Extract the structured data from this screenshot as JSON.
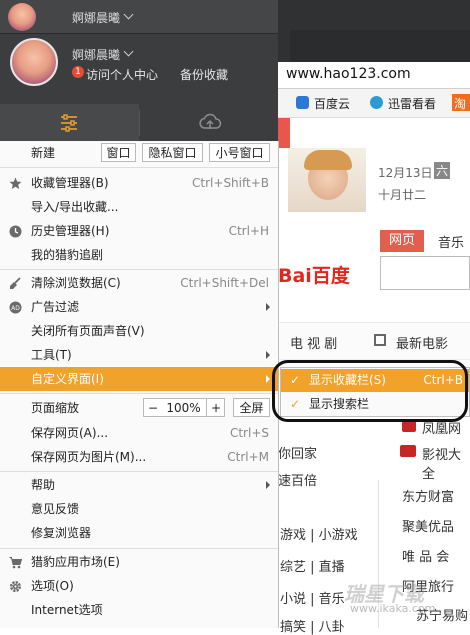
{
  "profile": {
    "username": "婀娜晨曦",
    "badge_count": "1",
    "personal_center": "访问个人中心",
    "backup": "备份收藏"
  },
  "browser": {
    "url": "www.hao123.com",
    "favorites": [
      {
        "label": "百度云",
        "icon": "cloud-icon"
      },
      {
        "label": "迅雷看看",
        "icon": "play-icon"
      },
      {
        "label": "淘",
        "icon": "taobao-icon"
      }
    ]
  },
  "page": {
    "date": "12月13日",
    "weekday": "六",
    "lunar": "十月廿二",
    "baidu_logo": "Bai百度",
    "search_tabs": [
      "网页",
      "音乐"
    ],
    "nav": [
      "电 视 剧",
      "最新电影"
    ],
    "side_links": [
      "凤凰网",
      "影视大全"
    ],
    "left_links": [
      "你回家",
      "速百倍"
    ],
    "grid_links": [
      "游戏 | 小游戏",
      "综艺 | 直播",
      "小说 | 音乐",
      "搞笑 | 八卦"
    ],
    "right_links": [
      "东方财富",
      "聚美优品",
      "唯 品 会",
      "阿里旅行",
      "苏宁易购"
    ],
    "watermark": "瑞星下载",
    "watermark_url": "www.ikaka.com"
  },
  "menu": {
    "new_label": "新建",
    "new_buttons": [
      "窗口",
      "隐私窗口",
      "小号窗口"
    ],
    "items": [
      {
        "label": "收藏管理器(B)",
        "shortcut": "Ctrl+Shift+B",
        "icon": "star-icon"
      },
      {
        "label": "导入/导出收藏...",
        "shortcut": ""
      },
      {
        "label": "历史管理器(H)",
        "shortcut": "Ctrl+H",
        "icon": "history-icon"
      },
      {
        "label": "我的猎豹追剧",
        "shortcut": ""
      },
      {
        "label": "清除浏览数据(C)",
        "shortcut": "Ctrl+Shift+Del",
        "icon": "broom-icon"
      },
      {
        "label": "广告过滤",
        "shortcut": "",
        "icon": "adblock-icon"
      },
      {
        "label": "关闭所有页面声音(V)",
        "shortcut": ""
      },
      {
        "label": "工具(T)",
        "shortcut": ""
      },
      {
        "label": "自定义界面(I)",
        "shortcut": ""
      },
      {
        "label": "页面缩放",
        "shortcut": ""
      },
      {
        "label": "保存网页(A)...",
        "shortcut": "Ctrl+S"
      },
      {
        "label": "保存网页为图片(M)...",
        "shortcut": "Ctrl+M"
      },
      {
        "label": "帮助",
        "shortcut": ""
      },
      {
        "label": "意见反馈",
        "shortcut": ""
      },
      {
        "label": "修复浏览器",
        "shortcut": ""
      },
      {
        "label": "猎豹应用市场(E)",
        "shortcut": "",
        "icon": "cart-icon"
      },
      {
        "label": "选项(O)",
        "shortcut": "",
        "icon": "gear-icon"
      },
      {
        "label": "Internet选项",
        "shortcut": ""
      }
    ],
    "zoom": {
      "minus": "−",
      "value": "100%",
      "plus": "+",
      "fullscreen": "全屏"
    }
  },
  "submenu": {
    "items": [
      {
        "label": "显示收藏栏(S)",
        "shortcut": "Ctrl+B",
        "check": "✓"
      },
      {
        "label": "显示搜索栏",
        "shortcut": "",
        "check": "✓"
      }
    ]
  },
  "colors": {
    "accent": "#f0a22a",
    "panel": "#3b3d3f",
    "baidu_red": "#e0261f",
    "baidu_blue": "#2932e1"
  }
}
